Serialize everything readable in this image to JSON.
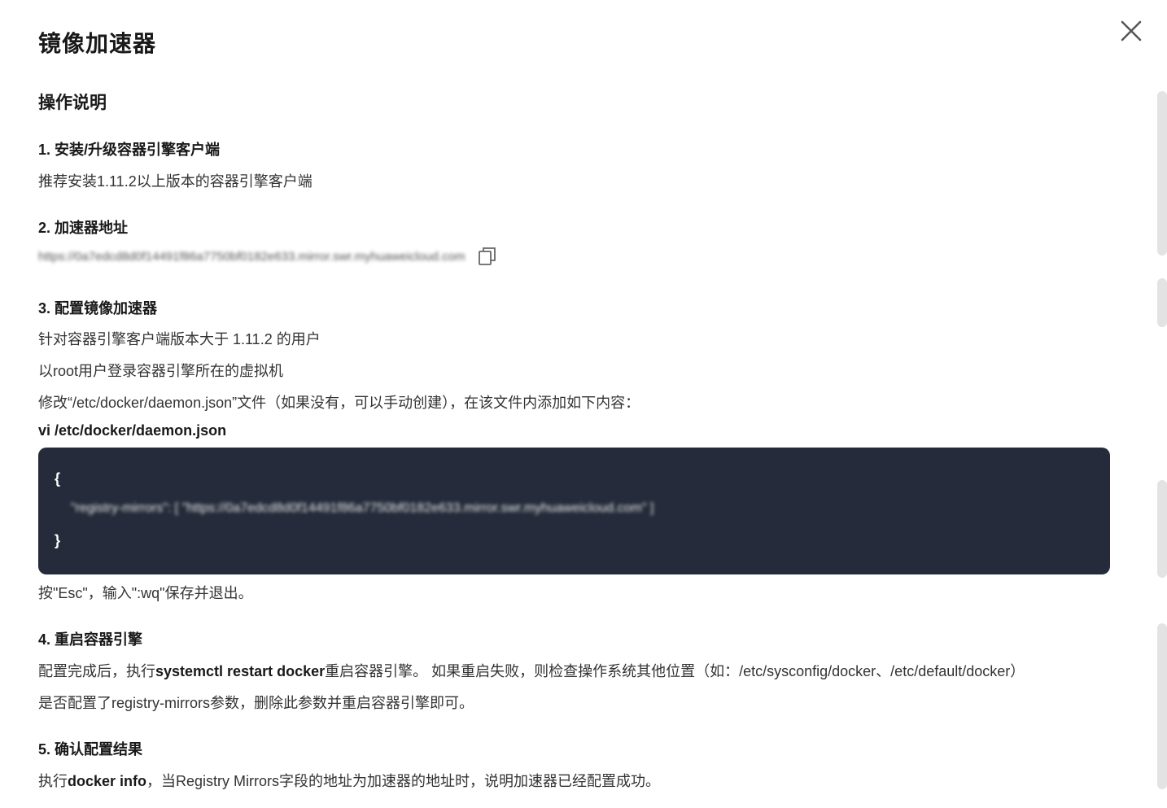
{
  "dialog": {
    "title": "镜像加速器",
    "close_icon": "close-icon"
  },
  "section_title": "操作说明",
  "steps": [
    {
      "title": "1. 安装/升级容器引擎客户端",
      "lines": [
        "推荐安装1.11.2以上版本的容器引擎客户端"
      ]
    },
    {
      "title": "2. 加速器地址",
      "address": "https://0a7edcd8d0f14491f86a7750bf0182e633.mirror.swr.myhuaweicloud.com",
      "copy_icon": "copy-icon"
    },
    {
      "title": "3. 配置镜像加速器",
      "lines": [
        "针对容器引擎客户端版本大于 1.11.2 的用户",
        "以root用户登录容器引擎所在的虚拟机",
        "修改“/etc/docker/daemon.json”文件（如果没有，可以手动创建），在该文件内添加如下内容："
      ],
      "command": "vi /etc/docker/daemon.json",
      "code": {
        "open": "{",
        "content": "\"registry-mirrors\": [ \"https://0a7edcd8d0f14491f86a7750bf0182e633.mirror.swr.myhuaweicloud.com\" ]",
        "close": "}"
      },
      "after": "按\"Esc\"，输入\":wq\"保存并退出。"
    },
    {
      "title": "4. 重启容器引擎",
      "line1_prefix": "配置完成后，执行",
      "line1_bold": "systemctl restart docker",
      "line1_suffix": "重启容器引擎。 如果重启失败，则检查操作系统其他位置（如：/etc/sysconfig/docker、/etc/default/docker）",
      "line2": "是否配置了registry-mirrors参数，删除此参数并重启容器引擎即可。"
    },
    {
      "title": "5. 确认配置结果",
      "line_prefix": "执行",
      "line_bold": "docker info",
      "line_suffix": "，当Registry Mirrors字段的地址为加速器的地址时，说明加速器已经配置成功。"
    }
  ]
}
